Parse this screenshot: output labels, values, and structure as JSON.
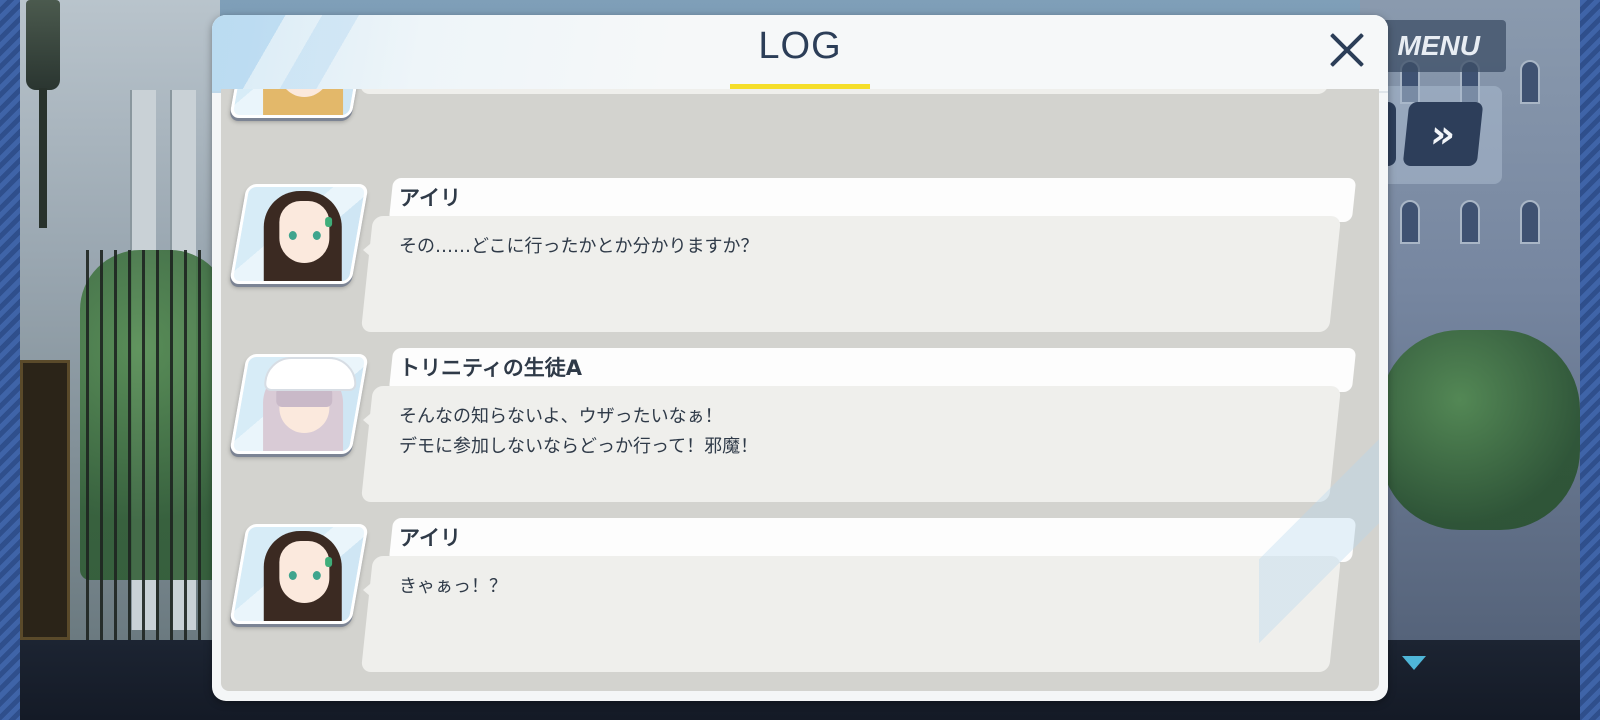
{
  "dialog": {
    "title": "LOG"
  },
  "hud": {
    "menu_label": "MENU",
    "fast_forward_glyph": "»"
  },
  "log": {
    "entries": [
      {
        "speaker": "アイリ",
        "lines": [
          "その……どこに行ったかとか分かりますか？"
        ]
      },
      {
        "speaker": "トリニティの生徒A",
        "lines": [
          "そんなの知らないよ、ウザったいなぁ！",
          "デモに参加しないならどっか行って！邪魔！"
        ]
      },
      {
        "speaker": "アイリ",
        "lines": [
          "きゃぁっ！？"
        ]
      }
    ]
  },
  "colors": {
    "title_text": "#2c3e58",
    "title_underline": "#f5de2a",
    "bubble": "#efefec",
    "log_background": "#d3d3cf"
  }
}
